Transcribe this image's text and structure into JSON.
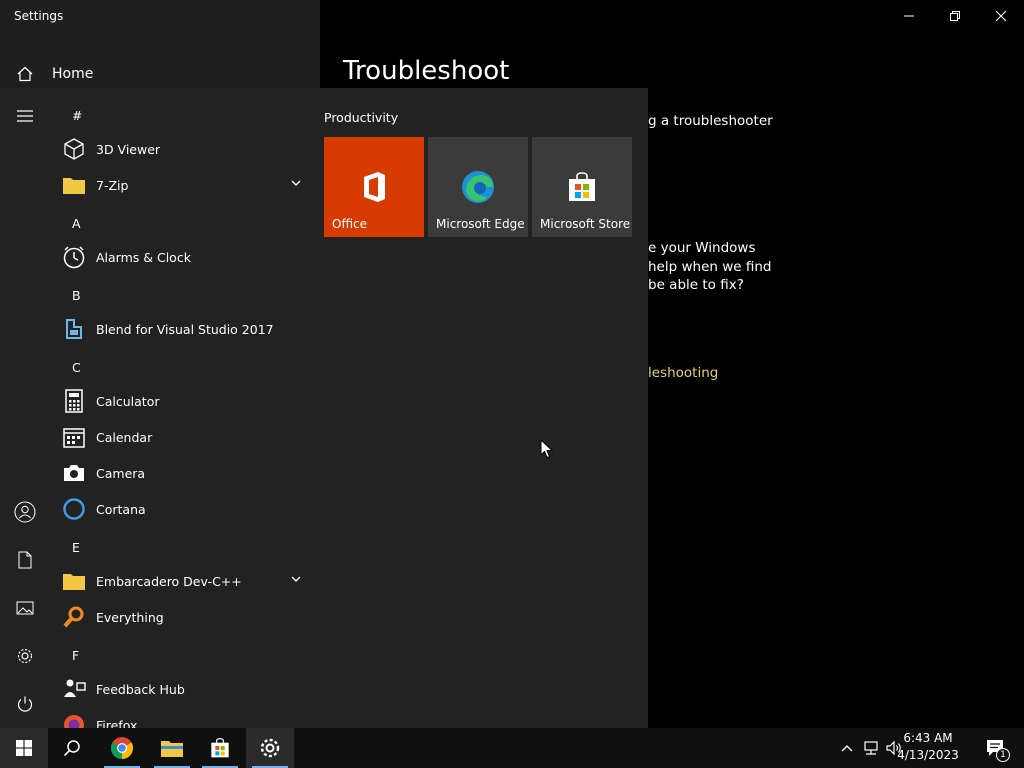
{
  "settings": {
    "window_title": "Settings",
    "home_label": "Home",
    "page_title": "Troubleshoot",
    "fragments": [
      "g a troubleshooter",
      "e your Windows",
      "help when we find",
      "be able to fix?"
    ],
    "link_fragment": "leshooting"
  },
  "start_menu": {
    "sections": [
      {
        "letter": "#",
        "apps": [
          {
            "name": "3D Viewer",
            "icon": "cube-icon"
          },
          {
            "name": "7-Zip",
            "icon": "folder-icon",
            "expandable": true
          }
        ]
      },
      {
        "letter": "A",
        "apps": [
          {
            "name": "Alarms & Clock",
            "icon": "clock-icon"
          }
        ]
      },
      {
        "letter": "B",
        "apps": [
          {
            "name": "Blend for Visual Studio 2017",
            "icon": "blend-icon"
          }
        ]
      },
      {
        "letter": "C",
        "apps": [
          {
            "name": "Calculator",
            "icon": "calculator-icon"
          },
          {
            "name": "Calendar",
            "icon": "calendar-icon"
          },
          {
            "name": "Camera",
            "icon": "camera-icon"
          },
          {
            "name": "Cortana",
            "icon": "cortana-icon"
          }
        ]
      },
      {
        "letter": "E",
        "apps": [
          {
            "name": "Embarcadero Dev-C++",
            "icon": "folder-icon",
            "expandable": true
          },
          {
            "name": "Everything",
            "icon": "magnifier-icon"
          }
        ]
      },
      {
        "letter": "F",
        "apps": [
          {
            "name": "Feedback Hub",
            "icon": "feedback-icon"
          },
          {
            "name": "Firefox",
            "icon": "firefox-icon"
          }
        ]
      }
    ],
    "tiles_group_title": "Productivity",
    "tiles": [
      {
        "label": "Office",
        "color": "#d83b01"
      },
      {
        "label": "Microsoft Edge",
        "color": "#3b3b3b"
      },
      {
        "label": "Microsoft Store",
        "color": "#3b3b3b"
      }
    ]
  },
  "taskbar": {
    "time": "6:43 AM",
    "date": "4/13/2023",
    "notification_count": "1"
  },
  "colors": {
    "accent": "#7ab3e6",
    "link": "#e3d36b",
    "office": "#d83b01"
  }
}
